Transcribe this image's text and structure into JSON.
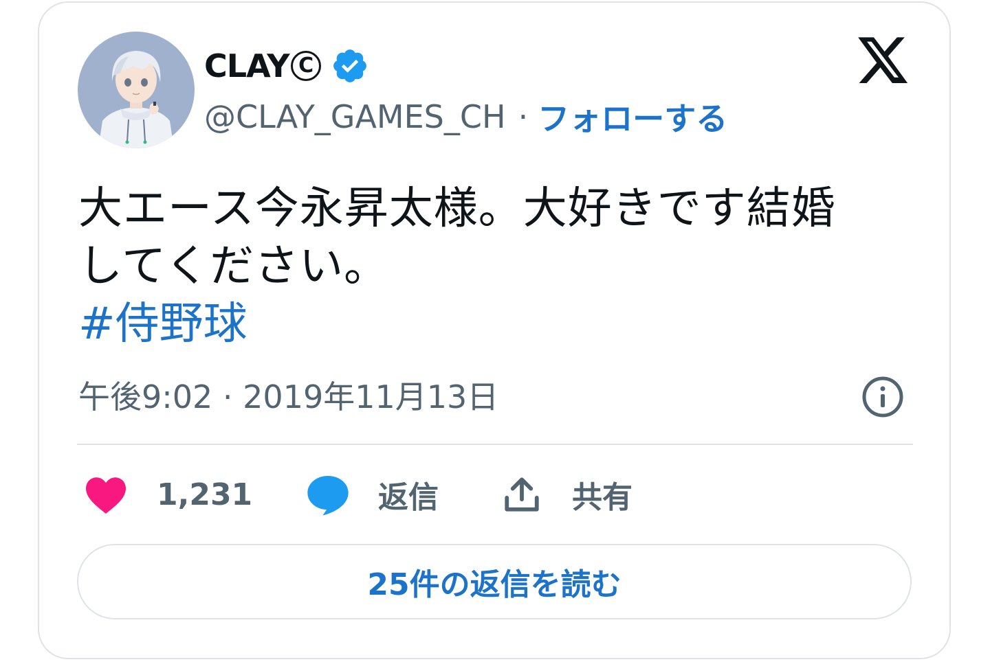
{
  "user": {
    "display_name": "CLAY",
    "copyright_symbol": "C",
    "handle": "@CLAY_GAMES_CH",
    "separator": "·",
    "follow_label": "フォローする",
    "verified": true
  },
  "tweet": {
    "text_line1": "大エース今永昇太様。大好きです結婚",
    "text_line2": "してください。",
    "hashtag": "#侍野球",
    "timestamp": "午後9:02 · 2019年11月13日"
  },
  "actions": {
    "like_count": "1,231",
    "reply_label": "返信",
    "share_label": "共有"
  },
  "read_replies_label": "25件の返信を読む",
  "icons": {
    "x_logo": "x-logo-icon",
    "verified": "verified-badge-icon",
    "info": "info-icon",
    "like": "heart-icon",
    "reply": "speech-bubble-icon",
    "share": "share-upload-icon"
  },
  "colors": {
    "link_blue": "#1d73c9",
    "verified_blue": "#1d9bf0",
    "heart_pink": "#f91880",
    "text_primary": "#0f1419",
    "text_secondary": "#536471",
    "border": "#dfe3e6"
  }
}
